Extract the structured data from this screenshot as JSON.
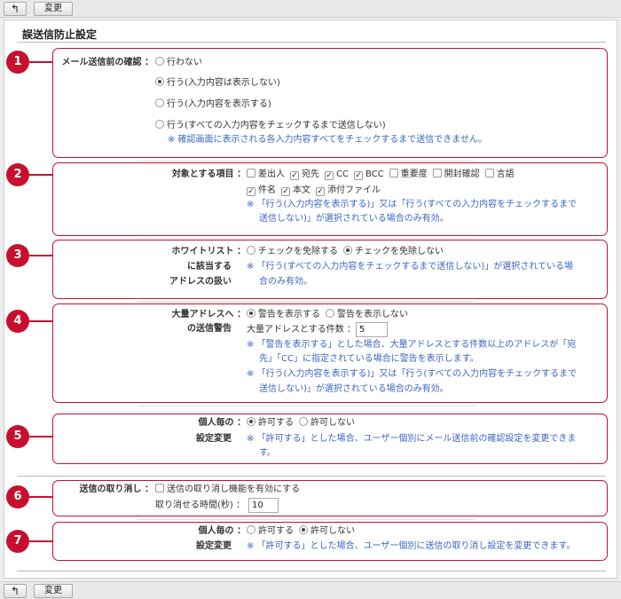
{
  "toolbar": {
    "back_icon": "↰",
    "change_label": "変更"
  },
  "page": {
    "title": "誤送信防止設定"
  },
  "badges": [
    "1",
    "2",
    "3",
    "4",
    "5",
    "6",
    "7"
  ],
  "s1": {
    "label": "メール送信前の確認 ：",
    "options": [
      {
        "label": "行わない",
        "selected": false
      },
      {
        "label": "行う(入力内容は表示しない)",
        "selected": true
      },
      {
        "label": "行う(入力内容を表示する)",
        "selected": false
      },
      {
        "label": "行う(すべての入力内容をチェックするまで送信しない)",
        "selected": false
      }
    ],
    "note": "※ 確認画面に表示される各入力内容すべてをチェックするまで送信できません。"
  },
  "s2": {
    "label": "対象とする項目 ：",
    "row1": [
      {
        "label": "差出人",
        "checked": false
      },
      {
        "label": "宛先",
        "checked": true
      },
      {
        "label": "CC",
        "checked": true
      },
      {
        "label": "BCC",
        "checked": true
      },
      {
        "label": "重要度",
        "checked": false
      },
      {
        "label": "開封確認",
        "checked": false
      },
      {
        "label": "言語",
        "checked": false
      }
    ],
    "row2": [
      {
        "label": "件名",
        "checked": true
      },
      {
        "label": "本文",
        "checked": true
      },
      {
        "label": "添付ファイル",
        "checked": true
      }
    ],
    "note1": "※ 「行う(入力内容を表示する)」又は「行う(すべての入力内容をチェックするまで",
    "note2": "送信しない)」が選択されている場合のみ有効。"
  },
  "s3": {
    "label1": "ホワイトリスト ：",
    "label2": "に該当する",
    "label3": "アドレスの扱い",
    "options": [
      {
        "label": "チェックを免除する",
        "selected": false
      },
      {
        "label": "チェックを免除しない",
        "selected": true
      }
    ],
    "note1": "※ 「行う(すべての入力内容をチェックするまで送信しない)」が選択されている場",
    "note2": "合のみ有効。"
  },
  "s4": {
    "label1": "大量アドレスへ ：",
    "label2": "の送信警告",
    "options": [
      {
        "label": "警告を表示する",
        "selected": true
      },
      {
        "label": "警告を表示しない",
        "selected": false
      }
    ],
    "count_label": "大量アドレスとする件数 ：",
    "count_value": "5",
    "note1": "※ 「警告を表示する」とした場合、大量アドレスとする件数以上のアドレスが「宛",
    "note2": "先」「CC」に指定されている場合に警告を表示します。",
    "note3": "※ 「行う(入力内容を表示する)」又は「行う(すべての入力内容をチェックするまで",
    "note4": "送信しない)」が選択されている場合のみ有効。"
  },
  "s5": {
    "label1": "個人毎の ：",
    "label2": "設定変更",
    "options": [
      {
        "label": "許可する",
        "selected": true
      },
      {
        "label": "許可しない",
        "selected": false
      }
    ],
    "note1": "※ 「許可する」とした場合、ユーザー個別にメール送信前の確認設定を変更できま",
    "note2": "す。"
  },
  "s6": {
    "label": "送信の取り消し ：",
    "checkbox": {
      "label": "送信の取り消し機能を有効にする",
      "checked": false
    },
    "time_label": "取り消せる時間(秒) ：",
    "time_value": "10"
  },
  "s7": {
    "label1": "個人毎の ：",
    "label2": "設定変更",
    "options": [
      {
        "label": "許可する",
        "selected": false
      },
      {
        "label": "許可しない",
        "selected": true
      }
    ],
    "note": "※ 「許可する」とした場合、ユーザー個別に送信の取り消し設定を変更できます。"
  }
}
